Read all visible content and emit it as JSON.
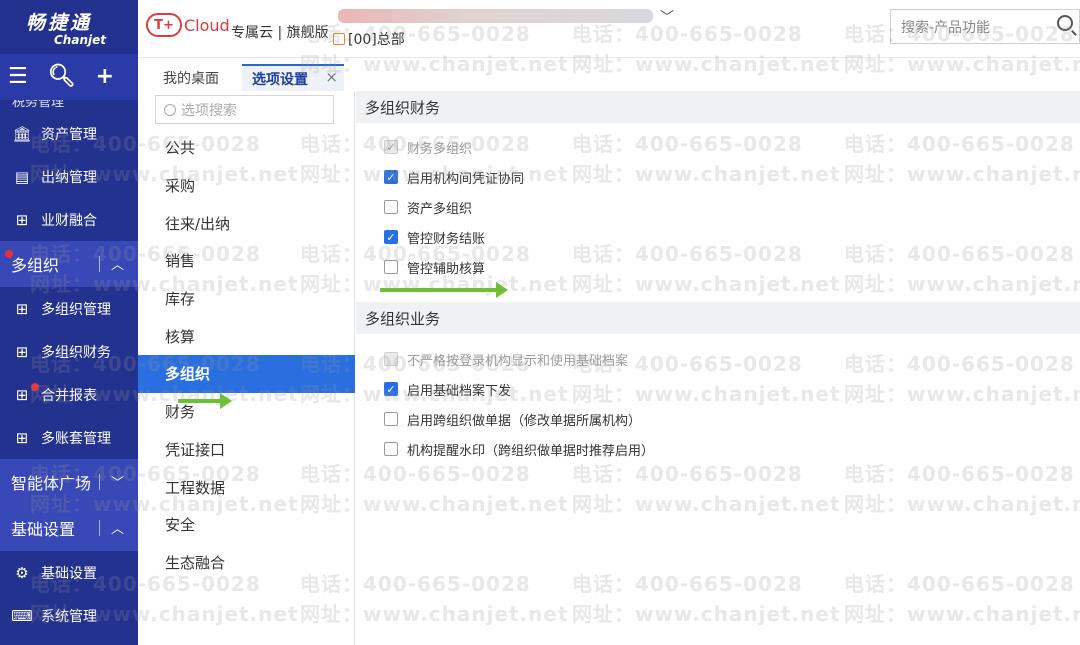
{
  "sidebar": {
    "logo_cn": "畅捷通",
    "logo_en": "Chanjet",
    "tools": [
      "menu-icon",
      "search-icon",
      "plus-icon"
    ],
    "cut_item": "税务管理",
    "items_top": [
      {
        "label": "资产管理",
        "icon": "bank-icon"
      },
      {
        "label": "出纳管理",
        "icon": "ledger-icon"
      },
      {
        "label": "业财融合",
        "icon": "grid-icon"
      }
    ],
    "group_multi": "多组织",
    "items_multi": [
      {
        "label": "多组织管理",
        "icon": "grid-icon"
      },
      {
        "label": "多组织财务",
        "icon": "grid-icon"
      },
      {
        "label": "合并报表",
        "icon": "grid-icon"
      },
      {
        "label": "多账套管理",
        "icon": "grid-icon"
      }
    ],
    "group_ai": "智能体广场",
    "group_basic": "基础设置",
    "items_basic": [
      {
        "label": "基础设置",
        "icon": "gear-icon"
      },
      {
        "label": "系统管理",
        "icon": "code-icon"
      }
    ]
  },
  "header": {
    "cloud_badge": "T+",
    "cloud_word": "Cloud",
    "edition": "专属云 | 旗舰版",
    "org": "[00]总部",
    "search_placeholder": "搜索-产品功能"
  },
  "tabs": {
    "home": "我的桌面",
    "active": "选项设置",
    "close": "×"
  },
  "categories": {
    "search_placeholder": "选项搜索",
    "items": [
      "公共",
      "采购",
      "往来/出纳",
      "销售",
      "库存",
      "核算",
      "多组织",
      "财务",
      "凭证接口",
      "工程数据",
      "安全",
      "生态融合"
    ]
  },
  "sections": {
    "finance_title": "多组织财务",
    "finance_options": [
      {
        "label": "财务多组织",
        "state": "disabled-checked"
      },
      {
        "label": "启用机构间凭证协同",
        "state": "checked"
      },
      {
        "label": "资产多组织",
        "state": "unchecked"
      },
      {
        "label": "管控财务结账",
        "state": "checked"
      },
      {
        "label": "管控辅助核算",
        "state": "unchecked"
      }
    ],
    "business_title": "多组织业务",
    "business_options": [
      {
        "label": "不严格按登录机构显示和使用基础档案",
        "state": "disabled"
      },
      {
        "label": "启用基础档案下发",
        "state": "checked"
      },
      {
        "label": "启用跨组织做单据（修改单据所属机构）",
        "state": "unchecked"
      },
      {
        "label": "机构提醒水印（跨组织做单据时推荐启用）",
        "state": "unchecked"
      }
    ]
  },
  "watermark": {
    "phone": "电话：400-665-0028",
    "site": "网址：www.chanjet.net"
  },
  "colors": {
    "sidebar": "#23318f",
    "accent": "#2a6fe0",
    "arrow": "#6cc22f"
  }
}
